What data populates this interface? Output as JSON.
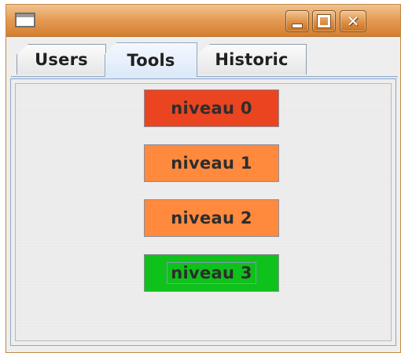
{
  "window": {
    "title": "",
    "controls": {
      "minimize_icon": "minimize-icon",
      "maximize_icon": "maximize-icon",
      "close_icon": "close-icon"
    }
  },
  "tabs": [
    {
      "label": "Users",
      "selected": false
    },
    {
      "label": "Tools",
      "selected": true
    },
    {
      "label": "Historic",
      "selected": false
    }
  ],
  "levels": [
    {
      "label": "niveau 0",
      "color": "#ea4421"
    },
    {
      "label": "niveau 1",
      "color": "#ff8a3e"
    },
    {
      "label": "niveau 2",
      "color": "#ff8a3e"
    },
    {
      "label": "niveau 3",
      "color": "#0fc11b",
      "focused": true
    }
  ],
  "theme": {
    "titlebar_color": "#e49b55",
    "selected_tab_color": "#dce9f8",
    "panel_border_color": "#8fa7c6"
  }
}
